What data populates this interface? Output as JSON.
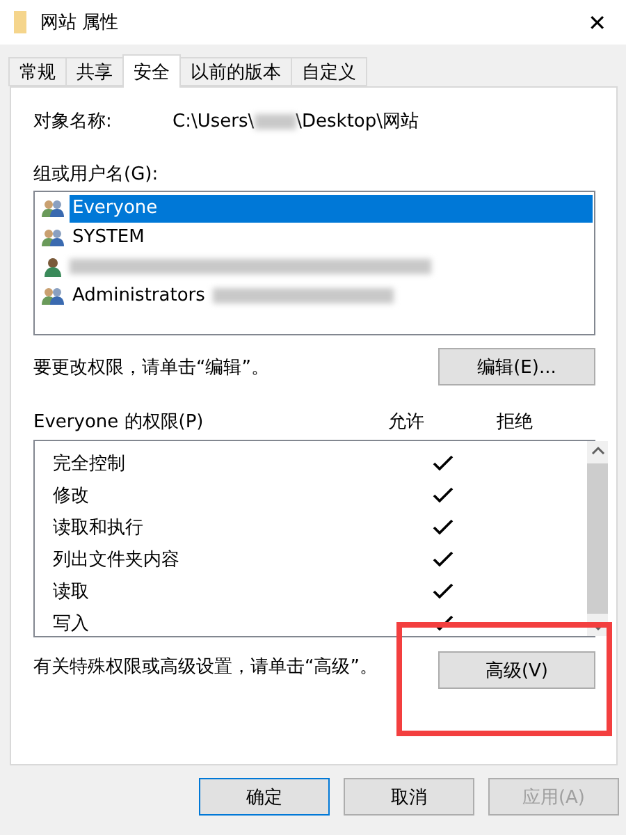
{
  "window": {
    "title": "网站 属性",
    "close": "✕"
  },
  "tabs": [
    {
      "label": "常规",
      "selected": false
    },
    {
      "label": "共享",
      "selected": false
    },
    {
      "label": "安全",
      "selected": true
    },
    {
      "label": "以前的版本",
      "selected": false
    },
    {
      "label": "自定义",
      "selected": false
    }
  ],
  "object": {
    "label": "对象名称:",
    "path_before": "C:\\Users\\",
    "path_after": "\\Desktop\\网站"
  },
  "users": {
    "label": "组或用户名(G):",
    "items": [
      {
        "kind": "group",
        "name": "Everyone",
        "selected": true
      },
      {
        "kind": "group",
        "name": "SYSTEM",
        "selected": false
      },
      {
        "kind": "user",
        "selected": false
      },
      {
        "kind": "group",
        "name": "Administrators",
        "selected": false
      }
    ]
  },
  "edit_hint": "要更改权限，请单击“编辑”。",
  "edit_button": "编辑(E)...",
  "permissions": {
    "label": "Everyone 的权限(P)",
    "allow_header": "允许",
    "deny_header": "拒绝",
    "rows": [
      {
        "name": "完全控制",
        "allow": true,
        "deny": false
      },
      {
        "name": "修改",
        "allow": true,
        "deny": false
      },
      {
        "name": "读取和执行",
        "allow": true,
        "deny": false
      },
      {
        "name": "列出文件夹内容",
        "allow": true,
        "deny": false
      },
      {
        "name": "读取",
        "allow": true,
        "deny": false
      },
      {
        "name": "写入",
        "allow": true,
        "deny": false
      }
    ]
  },
  "advanced_hint": "有关特殊权限或高级设置，请单击“高级”。",
  "advanced_button": "高级(V)",
  "buttons": [
    {
      "label": "确定",
      "disabled": false,
      "default": true
    },
    {
      "label": "取消",
      "disabled": false,
      "default": false
    },
    {
      "label": "应用(A)",
      "disabled": true,
      "default": false
    }
  ]
}
